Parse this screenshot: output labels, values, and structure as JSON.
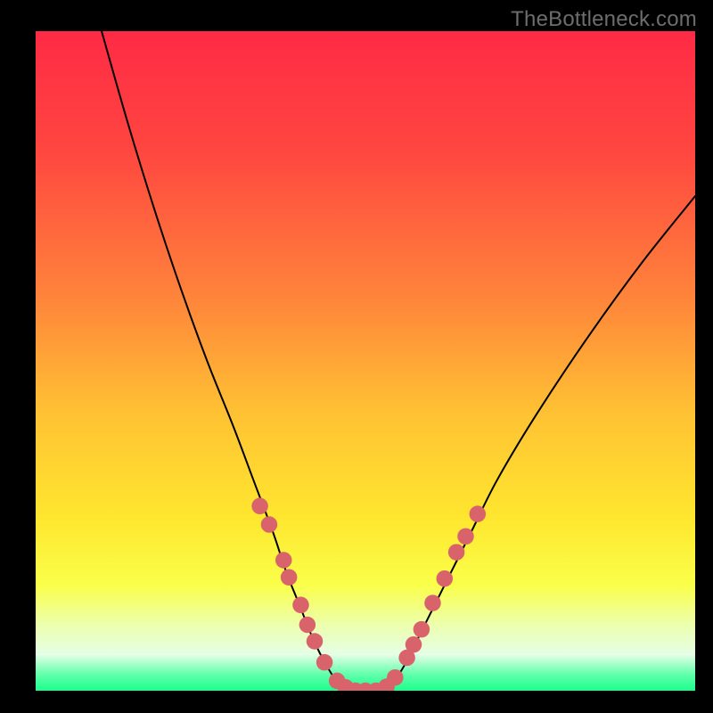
{
  "watermark": {
    "text": "TheBottleneck.com"
  },
  "colors": {
    "black": "#000000",
    "curve": "#000000",
    "marker": "#d9636b",
    "gradient_stops": [
      {
        "offset": 0.0,
        "color": "#ff2a45"
      },
      {
        "offset": 0.18,
        "color": "#ff4640"
      },
      {
        "offset": 0.4,
        "color": "#ff833b"
      },
      {
        "offset": 0.58,
        "color": "#ffc233"
      },
      {
        "offset": 0.74,
        "color": "#ffe72f"
      },
      {
        "offset": 0.84,
        "color": "#faff4a"
      },
      {
        "offset": 0.9,
        "color": "#ecffad"
      },
      {
        "offset": 0.945,
        "color": "#e6ffe6"
      },
      {
        "offset": 0.975,
        "color": "#62ffac"
      },
      {
        "offset": 1.0,
        "color": "#1aff8c"
      }
    ]
  },
  "chart_data": {
    "type": "line",
    "title": "",
    "xlabel": "",
    "ylabel": "",
    "xlim": [
      0,
      100
    ],
    "ylim": [
      0,
      100
    ],
    "series": [
      {
        "name": "bottleneck-curve",
        "x": [
          10,
          14,
          18,
          22,
          26,
          30,
          33,
          36,
          38,
          40,
          42,
          44,
          46,
          48,
          50,
          52,
          54,
          56,
          58,
          62,
          66,
          70,
          76,
          84,
          92,
          100
        ],
        "y": [
          100,
          86,
          73,
          61,
          50,
          40,
          32,
          24,
          18,
          13,
          8,
          4,
          1,
          0,
          0,
          0,
          1,
          4,
          8,
          16,
          24,
          32,
          42,
          54,
          65,
          75
        ]
      }
    ],
    "markers": [
      {
        "x": 34.0,
        "y": 28.0
      },
      {
        "x": 35.4,
        "y": 25.2
      },
      {
        "x": 37.6,
        "y": 19.8
      },
      {
        "x": 38.4,
        "y": 17.2
      },
      {
        "x": 40.2,
        "y": 13.0
      },
      {
        "x": 41.2,
        "y": 10.0
      },
      {
        "x": 42.3,
        "y": 7.5
      },
      {
        "x": 43.8,
        "y": 4.3
      },
      {
        "x": 45.7,
        "y": 1.5
      },
      {
        "x": 47.0,
        "y": 0.5
      },
      {
        "x": 48.5,
        "y": 0.0
      },
      {
        "x": 50.0,
        "y": 0.0
      },
      {
        "x": 51.6,
        "y": 0.0
      },
      {
        "x": 53.2,
        "y": 0.6
      },
      {
        "x": 54.5,
        "y": 2.0
      },
      {
        "x": 56.3,
        "y": 5.0
      },
      {
        "x": 57.3,
        "y": 7.0
      },
      {
        "x": 58.5,
        "y": 9.3
      },
      {
        "x": 60.2,
        "y": 13.3
      },
      {
        "x": 62.0,
        "y": 17.0
      },
      {
        "x": 63.8,
        "y": 21.0
      },
      {
        "x": 65.2,
        "y": 23.4
      },
      {
        "x": 67.0,
        "y": 26.8
      }
    ]
  }
}
